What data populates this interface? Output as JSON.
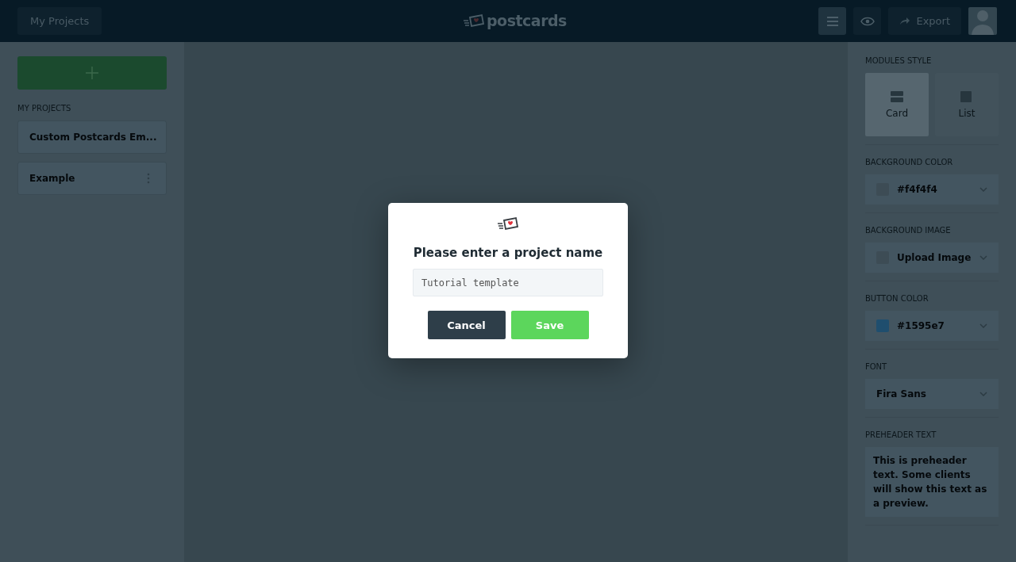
{
  "header": {
    "projects_button": "My Projects",
    "logo_text": "postcards",
    "export_button": "Export"
  },
  "sidebar": {
    "section_title": "MY PROJECTS",
    "projects": [
      {
        "name": "Custom Postcards Em..."
      },
      {
        "name": "Example"
      }
    ]
  },
  "settings": {
    "modules_style": {
      "title": "MODULES STYLE",
      "options": [
        {
          "label": "Card",
          "kind": "card",
          "selected": true
        },
        {
          "label": "List",
          "kind": "list",
          "selected": false
        }
      ]
    },
    "sections": [
      {
        "kind": "color",
        "title": "BACKGROUND COLOR",
        "value": "#f4f4f4",
        "color": "#3d4c55"
      },
      {
        "kind": "image",
        "title": "BACKGROUND IMAGE",
        "value": "Upload Image"
      },
      {
        "kind": "color",
        "title": "BUTTON COLOR",
        "value": "#1595e7",
        "color": "#1f4e6e"
      },
      {
        "kind": "font",
        "title": "FONT",
        "value": "Fira Sans"
      },
      {
        "kind": "text",
        "title": "PREHEADER TEXT",
        "value": "This is preheader text. Some clients will show this text as a preview."
      }
    ]
  },
  "dialog": {
    "title": "Please enter a project name",
    "input_value": "Tutorial template",
    "buttons": [
      {
        "label": "Cancel",
        "kind": "secondary"
      },
      {
        "label": "Save",
        "kind": "primary"
      }
    ]
  }
}
